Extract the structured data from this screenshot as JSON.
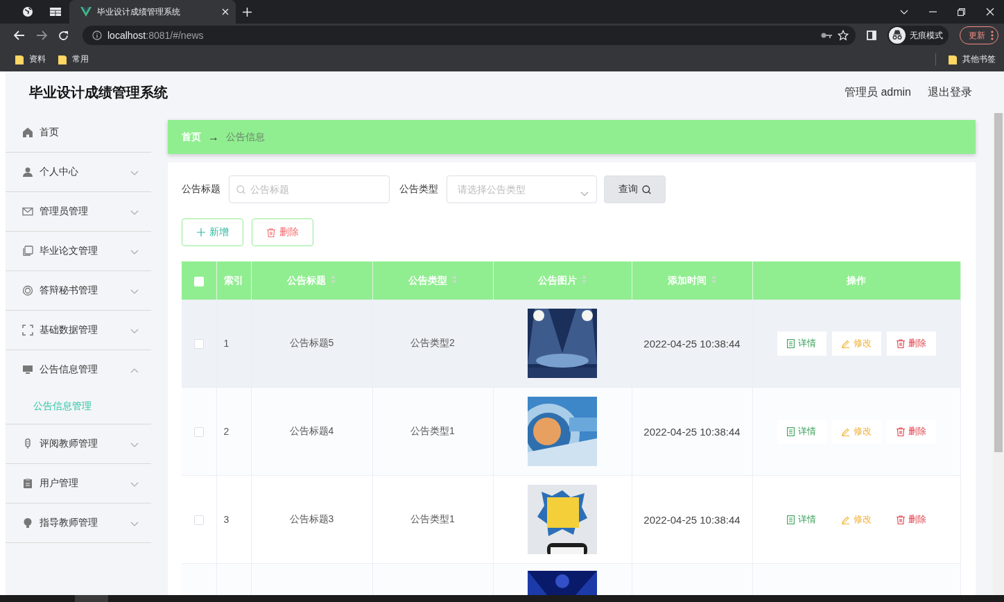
{
  "browser": {
    "tabs": [
      {
        "kind": "globe",
        "selected": false
      },
      {
        "kind": "sheet",
        "selected": false
      },
      {
        "kind": "page",
        "title": "毕业设计成绩管理系统",
        "selected": true
      }
    ],
    "address": {
      "host": "localhost",
      "path": ":8081/#/news"
    },
    "profile": "无痕模式",
    "update_button": "更新",
    "bookmarks": [
      "资料",
      "常用"
    ],
    "other_bookmarks": "其他书签"
  },
  "header": {
    "title": "毕业设计成绩管理系统",
    "user": "管理员 admin",
    "logout": "退出登录"
  },
  "sidebar": {
    "items": [
      {
        "label": "首页"
      },
      {
        "label": "个人中心",
        "expanded": false
      },
      {
        "label": "管理员管理",
        "expanded": false
      },
      {
        "label": "毕业论文管理",
        "expanded": false
      },
      {
        "label": "答辩秘书管理",
        "expanded": false
      },
      {
        "label": "基础数据管理",
        "expanded": false
      },
      {
        "label": "公告信息管理",
        "expanded": true,
        "children": [
          {
            "label": "公告信息管理",
            "selected": true
          }
        ]
      },
      {
        "label": "评阅教师管理",
        "expanded": false
      },
      {
        "label": "用户管理",
        "expanded": false
      },
      {
        "label": "指导教师管理",
        "expanded": false
      }
    ]
  },
  "breadcrumb": {
    "items": [
      "首页",
      "公告信息"
    ],
    "separator": "→"
  },
  "filters": [
    {
      "kind": "text",
      "label": "公告标题",
      "placeholder": "公告标题"
    },
    {
      "kind": "select",
      "label": "公告类型",
      "placeholder": "请选择公告类型"
    }
  ],
  "search_button": "查询",
  "actions": [
    {
      "kind": "add",
      "label": "新增"
    },
    {
      "kind": "delete",
      "label": "删除"
    }
  ],
  "table": {
    "columns": [
      {
        "kind": "checkbox",
        "checked": false
      },
      {
        "label": "索引",
        "sortable": false
      },
      {
        "label": "公告标题",
        "sortable": true
      },
      {
        "label": "公告类型",
        "sortable": true
      },
      {
        "label": "公告图片",
        "sortable": true
      },
      {
        "label": "添加时间",
        "sortable": true
      },
      {
        "label": "操作",
        "sortable": false
      }
    ],
    "rows": [
      {
        "checked": false,
        "highlighted": true,
        "index": "1",
        "title": "公告标题5",
        "type": "公告类型2",
        "image": {
          "kind": "picture"
        },
        "time": "2022-04-25 10:38:44",
        "actions": [
          {
            "kind": "detail",
            "label": "详情"
          },
          {
            "kind": "edit",
            "label": "修改"
          },
          {
            "kind": "delete",
            "label": "删除"
          }
        ]
      },
      {
        "checked": false,
        "highlighted": false,
        "index": "2",
        "title": "公告标题4",
        "type": "公告类型1",
        "image": {
          "kind": "picture"
        },
        "time": "2022-04-25 10:38:44",
        "actions": [
          {
            "kind": "detail",
            "label": "详情"
          },
          {
            "kind": "edit",
            "label": "修改"
          },
          {
            "kind": "delete",
            "label": "删除"
          }
        ]
      },
      {
        "checked": false,
        "highlighted": false,
        "index": "3",
        "title": "公告标题3",
        "type": "公告类型1",
        "image": {
          "kind": "picture"
        },
        "time": "2022-04-25 10:38:44",
        "actions": [
          {
            "kind": "detail",
            "label": "详情"
          },
          {
            "kind": "edit",
            "label": "修改"
          },
          {
            "kind": "delete",
            "label": "删除"
          }
        ]
      },
      {
        "highlighted": false,
        "image": {
          "kind": "picture"
        }
      }
    ]
  }
}
